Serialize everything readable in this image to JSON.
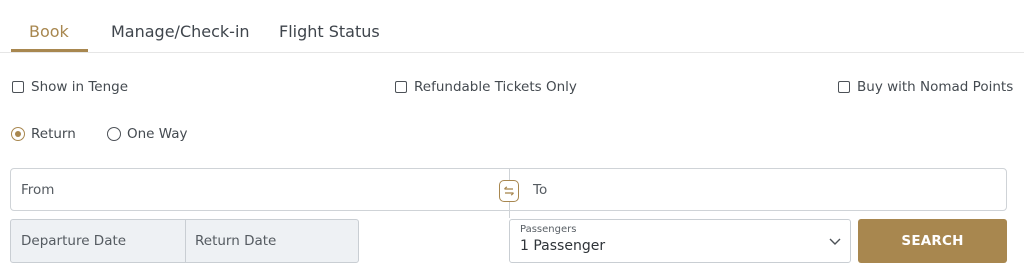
{
  "tabs": [
    {
      "label": "Book",
      "active": true
    },
    {
      "label": "Manage/Check-in",
      "active": false
    },
    {
      "label": "Flight Status",
      "active": false
    }
  ],
  "options": {
    "show_in_tenge": "Show in Tenge",
    "refundable_only": "Refundable Tickets Only",
    "nomad_points": "Buy with Nomad Points"
  },
  "trip_type": {
    "return_label": "Return",
    "one_way_label": "One Way",
    "selected": "Return"
  },
  "route": {
    "from_label": "From",
    "to_label": "To"
  },
  "dates": {
    "departure_label": "Departure Date",
    "return_label": "Return Date"
  },
  "passengers": {
    "caption": "Passengers",
    "value": "1 Passenger"
  },
  "search_button": "SEARCH",
  "colors": {
    "accent": "#a8874f",
    "text": "#3a3f45",
    "border": "#cfd3d7",
    "date_bg": "#eef1f4"
  },
  "icons": {
    "swap": "swap-icon",
    "dropdown": "chevron-down-icon"
  }
}
